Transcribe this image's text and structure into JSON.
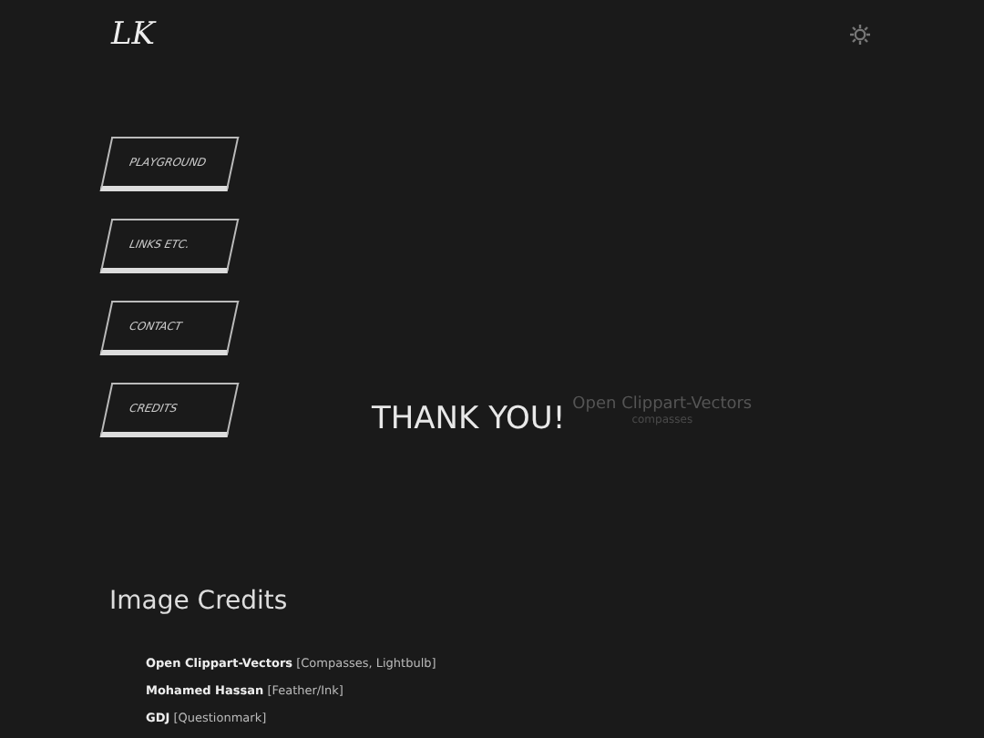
{
  "logo": "LK",
  "nav": [
    {
      "label": "PLAYGROUND"
    },
    {
      "label": "LINKS ETC."
    },
    {
      "label": "CONTACT"
    },
    {
      "label": "CREDITS"
    }
  ],
  "hero": {
    "title": "THANK YOU!",
    "credit_name": "Open Clippart-Vectors",
    "credit_item": "compasses"
  },
  "credits": {
    "heading": "Image Credits",
    "items": [
      "**Open Clippart-Vectors** [Compasses, Lightbulb]",
      "**Mohamed Hassan** [Feather/Ink]",
      "**GDJ** [Questionmark]"
    ]
  }
}
